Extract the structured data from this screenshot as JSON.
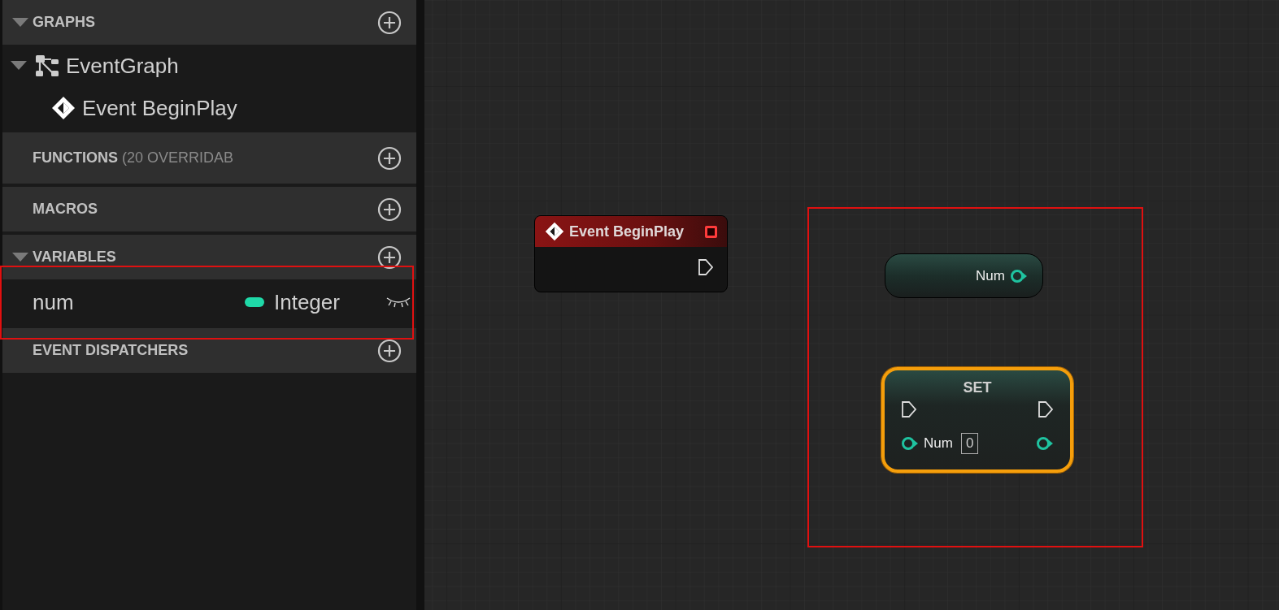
{
  "sections": [
    {
      "title": "GRAPHS",
      "expanded": true,
      "items": [
        {
          "label": "EventGraph",
          "kind": "graph",
          "expanded": true,
          "children": [
            {
              "label": "Event BeginPlay",
              "kind": "event"
            }
          ]
        }
      ]
    },
    {
      "title": "FUNCTIONS",
      "note": "(20 OVERRIDAB"
    },
    {
      "title": "MACROS"
    },
    {
      "title": "VARIABLES",
      "expanded": true,
      "variables": [
        {
          "name": "num",
          "type": "Integer",
          "color": "#1fd9a8"
        }
      ]
    },
    {
      "title": "EVENT DISPATCHERS"
    }
  ],
  "nodes": [
    {
      "kind": "event",
      "title": "Event BeginPlay"
    },
    {
      "kind": "getter",
      "label": "Num"
    },
    {
      "kind": "setter",
      "title": "SET",
      "selected": true,
      "input_label": "Num",
      "input_value": "0"
    }
  ]
}
